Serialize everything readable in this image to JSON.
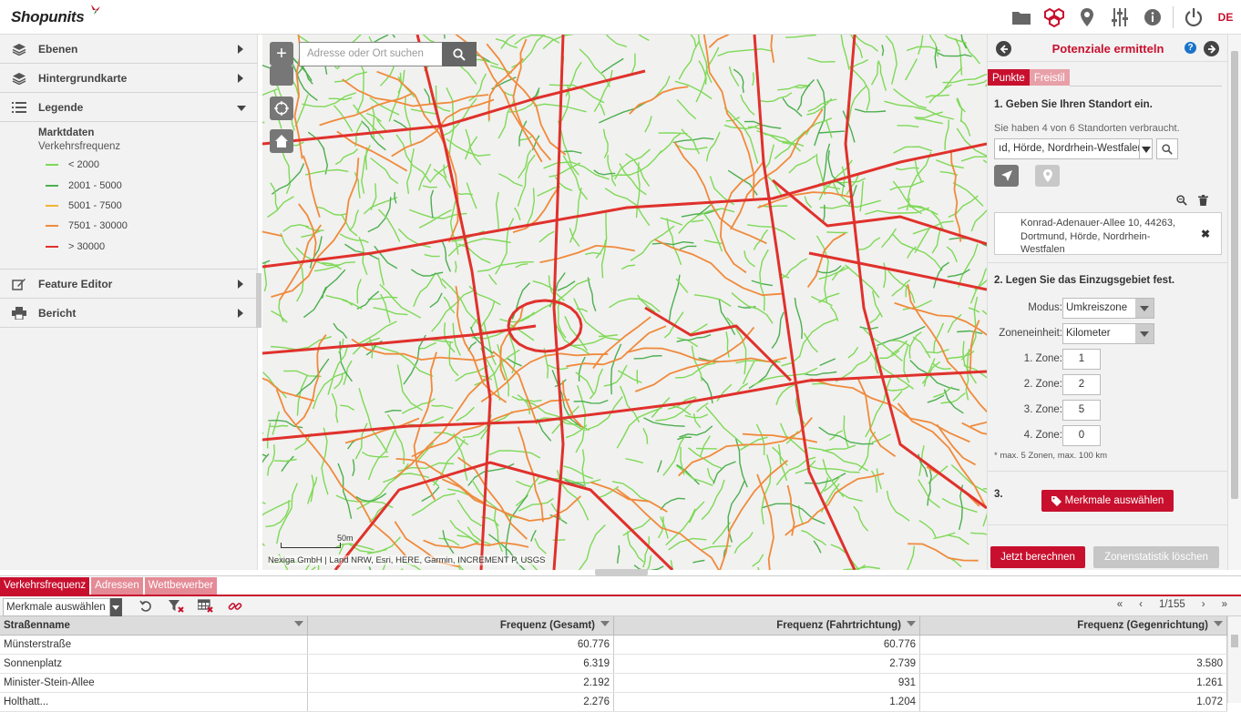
{
  "app": {
    "logo": "Shopunits",
    "lang": "DE",
    "top_icons": [
      "folder-icon",
      "hexagon-network-icon",
      "location-pin-icon",
      "sliders-icon",
      "info-icon",
      "power-icon"
    ]
  },
  "sidebar": {
    "items": [
      {
        "label": "Ebenen",
        "icon": "layers-icon"
      },
      {
        "label": "Hintergrundkarte",
        "icon": "layers-icon"
      },
      {
        "label": "Legende",
        "icon": "list-icon"
      },
      {
        "label": "Feature Editor",
        "icon": "edit-icon"
      },
      {
        "label": "Bericht",
        "icon": "print-icon"
      }
    ],
    "legend": {
      "title": "Marktdaten",
      "subtitle": "Verkehrsfrequenz",
      "entries": [
        {
          "label": "< 2000",
          "color": "#7ed957"
        },
        {
          "label": "2001 - 5000",
          "color": "#4caf50"
        },
        {
          "label": "5001 - 7500",
          "color": "#f5b335"
        },
        {
          "label": "7501 - 30000",
          "color": "#f08a3c"
        },
        {
          "label": "> 30000",
          "color": "#e0312c"
        }
      ]
    }
  },
  "map": {
    "search_placeholder": "Adresse oder Ort suchen",
    "attribution": "Nexiga GmbH | Land NRW, Esri, HERE, Garmin, INCREMENT P, USGS",
    "scale_label": "50m",
    "zoom_in_label": "+",
    "road_colors": {
      "low": "#7ed957",
      "mid": "#4caf50",
      "orange": "#f08a3c",
      "high": "#e0312c"
    }
  },
  "right_panel": {
    "title": "Potenziale ermitteln",
    "help": "?",
    "tabs": [
      {
        "label": "Punkte",
        "active": true
      },
      {
        "label": "Freistil",
        "active": false
      }
    ],
    "step1_title": "1. Geben Sie Ihren Standort ein.",
    "usage_note": "Sie haben 4 von 6 Standorten verbraucht.",
    "address_value": "ıd, Hörde, Nordrhein-Westfalen",
    "location_entry": "Konrad-Adenauer-Allee 10, 44263, Dortmund, Hörde, Nordrhein-Westfalen",
    "step2_title": "2. Legen Sie das Einzugsgebiet fest.",
    "modus_label": "Modus:",
    "modus_value": "Umkreiszone",
    "unit_label": "Zoneneinheit:",
    "unit_value": "Kilometer",
    "zones": [
      {
        "label": "1. Zone:",
        "value": "1"
      },
      {
        "label": "2. Zone:",
        "value": "2"
      },
      {
        "label": "3. Zone:",
        "value": "5"
      },
      {
        "label": "4. Zone:",
        "value": "0"
      }
    ],
    "zone_note": "* max. 5 Zonen, max. 100 km",
    "step3_label": "3.",
    "features_button": "Merkmale auswählen",
    "compute_button": "Jetzt berechnen",
    "clear_button": "Zonenstatistik löschen"
  },
  "bottom": {
    "tabs": [
      {
        "label": "Verkehrsfrequenz",
        "active": true
      },
      {
        "label": "Adressen",
        "active": false
      },
      {
        "label": "Wettbewerber",
        "active": false
      }
    ],
    "select_value": "Merkmale auswählen",
    "pager": "1/155",
    "columns": [
      "Straßenname",
      "Frequenz (Gesamt)",
      "Frequenz (Fahrtrichtung)",
      "Frequenz (Gegenrichtung)"
    ],
    "rows": [
      [
        "Münsterstraße",
        "60.776",
        "60.776",
        ""
      ],
      [
        "Sonnenplatz",
        "6.319",
        "2.739",
        "3.580"
      ],
      [
        "Minister-Stein-Allee",
        "2.192",
        "931",
        "1.261"
      ],
      [
        "Holthatt...",
        "2.276",
        "1.204",
        "1.072"
      ]
    ]
  }
}
